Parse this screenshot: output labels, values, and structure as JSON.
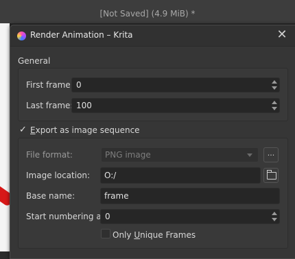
{
  "window": {
    "status_text": "[Not Saved]  (4.9 MiB) *"
  },
  "dialog": {
    "title": "Render Animation – Krita",
    "general_label": "General",
    "first_frame_label": "First frame:",
    "first_frame_value": "0",
    "last_frame_label": "Last frame:",
    "last_frame_value": "100",
    "export_sequence": {
      "label_prefix": "E",
      "label_rest": "xport as image sequence",
      "checked": true
    },
    "file_format_label": "File format:",
    "file_format_value": "PNG image",
    "file_format_options_button": "...",
    "image_location_label": "Image location:",
    "image_location_value": "O:/",
    "base_name_label": "Base name:",
    "base_name_value": "frame",
    "start_numbering_label": "Start numbering at:",
    "start_numbering_value": "0",
    "only_unique": {
      "label_before": "Only ",
      "label_underlined": "U",
      "label_after": "nique Frames",
      "checked": false
    }
  },
  "icons": {
    "app": "krita-icon",
    "close": "close-icon",
    "folder": "folder-icon",
    "check": "checkmark-icon"
  }
}
